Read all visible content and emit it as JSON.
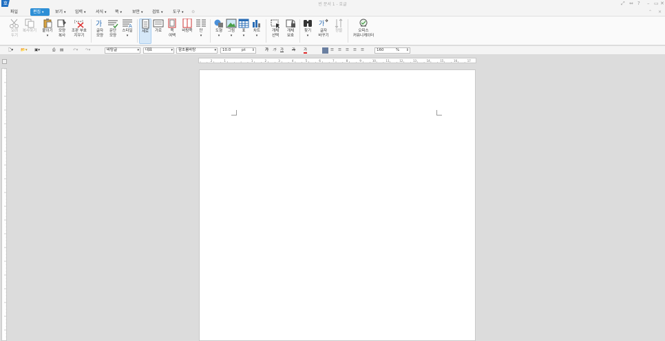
{
  "window": {
    "title": "빈 문서 1 - 호글",
    "logo": "호"
  },
  "menu": {
    "file": "파일",
    "items": [
      {
        "label": "편집",
        "active": true
      },
      {
        "label": "보기"
      },
      {
        "label": "입력"
      },
      {
        "label": "서식"
      },
      {
        "label": "쪽"
      },
      {
        "label": "보안"
      },
      {
        "label": "검토"
      },
      {
        "label": "도구"
      }
    ]
  },
  "ribbon": {
    "cut": "오려\n두기",
    "copy": "복사하기",
    "paste": "붙이기",
    "format_copy": "모양\n복사",
    "clear_format": "조판 부호\n지우기",
    "char_shape": "글자\n모양",
    "para_shape": "문단\n모양",
    "style": "스타일",
    "portrait": "세로",
    "landscape": "가로",
    "margin": "쪽\n여백",
    "background": "바탕쪽",
    "column": "단",
    "shape": "도형",
    "picture": "그림",
    "table": "표",
    "chart": "차트",
    "object_select": "개체\n선택",
    "object_protect": "개체\n보호",
    "find": "찾기",
    "replace": "글자\n바꾸기",
    "sort": "정렬",
    "community": "오피스\n커뮤니케이터"
  },
  "format": {
    "style": "바탕글",
    "font_group": "대표",
    "font": "함초롬바탕",
    "size": "10.0",
    "size_unit": "pt",
    "bold_glyph": "가",
    "italic_glyph": "가",
    "underline_glyph": "가",
    "strike_glyph": "가",
    "color_glyph": "가",
    "zoom": "160",
    "zoom_unit": "%"
  },
  "ruler": {
    "ticks": [
      "2",
      "1",
      "",
      "1",
      "2",
      "3",
      "4",
      "5",
      "6",
      "7",
      "8",
      "9",
      "10",
      "11",
      "12",
      "13",
      "14",
      "15",
      "16",
      "17",
      "18"
    ]
  },
  "colors": {
    "accent": "#2e8fd6",
    "logo": "#1f6fc2"
  }
}
